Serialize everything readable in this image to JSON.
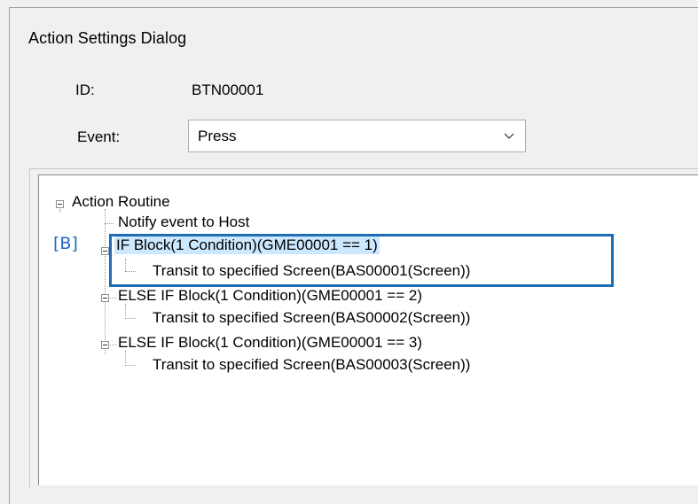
{
  "dialog": {
    "title": "Action Settings Dialog"
  },
  "fields": {
    "id_label": "ID:",
    "id_value": "BTN00001",
    "event_label": "Event:",
    "event_value": "Press"
  },
  "tree": {
    "root": "Action Routine",
    "items": [
      "Notify event to Host",
      "IF Block(1 Condition)(GME00001 == 1)",
      "Transit to specified Screen(BAS00001(Screen))",
      "ELSE IF Block(1 Condition)(GME00001 == 2)",
      "Transit to specified Screen(BAS00002(Screen))",
      "ELSE IF Block(1 Condition)(GME00001 == 3)",
      "Transit to specified Screen(BAS00003(Screen))"
    ]
  },
  "annotation": {
    "marker": "[B]",
    "color": "#1f6db5"
  },
  "icons": {
    "dropdown": "chevron-down-icon",
    "expander": "tree-collapse-icon"
  }
}
